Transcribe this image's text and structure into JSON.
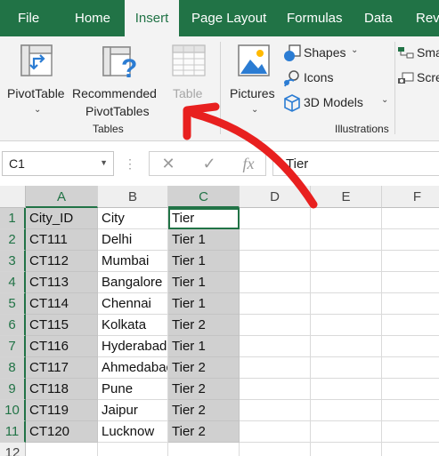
{
  "tabs": [
    {
      "label": "File",
      "active": false
    },
    {
      "label": "Home",
      "active": false
    },
    {
      "label": "Insert",
      "active": true
    },
    {
      "label": "Page Layout",
      "active": false
    },
    {
      "label": "Formulas",
      "active": false
    },
    {
      "label": "Data",
      "active": false
    },
    {
      "label": "Rev",
      "active": false
    }
  ],
  "ribbon": {
    "tables_group": {
      "label": "Tables",
      "pivottable": "PivotTable",
      "recommended_line1": "Recommended",
      "recommended_line2": "PivotTables",
      "table": "Table"
    },
    "illustrations_group": {
      "label": "Illustrations",
      "pictures": "Pictures",
      "shapes": "Shapes",
      "icons": "Icons",
      "models": "3D Models"
    },
    "extra": {
      "smartart": "Sma",
      "screenshot": "Scre"
    }
  },
  "formula_bar": {
    "name_box": "C1",
    "fx": "fx",
    "value": "Tier"
  },
  "sheet": {
    "columns": [
      "A",
      "B",
      "C",
      "D",
      "E",
      "F"
    ],
    "rows": [
      "1",
      "2",
      "3",
      "4",
      "5",
      "6",
      "7",
      "8",
      "9",
      "10",
      "11",
      "12"
    ],
    "cells": [
      [
        "City_ID",
        "City",
        "Tier"
      ],
      [
        "CT111",
        "Delhi",
        "Tier 1"
      ],
      [
        "CT112",
        "Mumbai",
        "Tier 1"
      ],
      [
        "CT113",
        "Bangalore",
        "Tier 1"
      ],
      [
        "CT114",
        "Chennai",
        "Tier 1"
      ],
      [
        "CT115",
        "Kolkata",
        "Tier 2"
      ],
      [
        "CT116",
        "Hyderabad",
        "Tier 1"
      ],
      [
        "CT117",
        "Ahmedabad",
        "Tier 2"
      ],
      [
        "CT118",
        "Pune",
        "Tier 2"
      ],
      [
        "CT119",
        "Jaipur",
        "Tier 2"
      ],
      [
        "CT120",
        "Lucknow",
        "Tier 2"
      ]
    ]
  },
  "colors": {
    "accent": "#217346",
    "annotation_arrow": "#e8201f"
  }
}
